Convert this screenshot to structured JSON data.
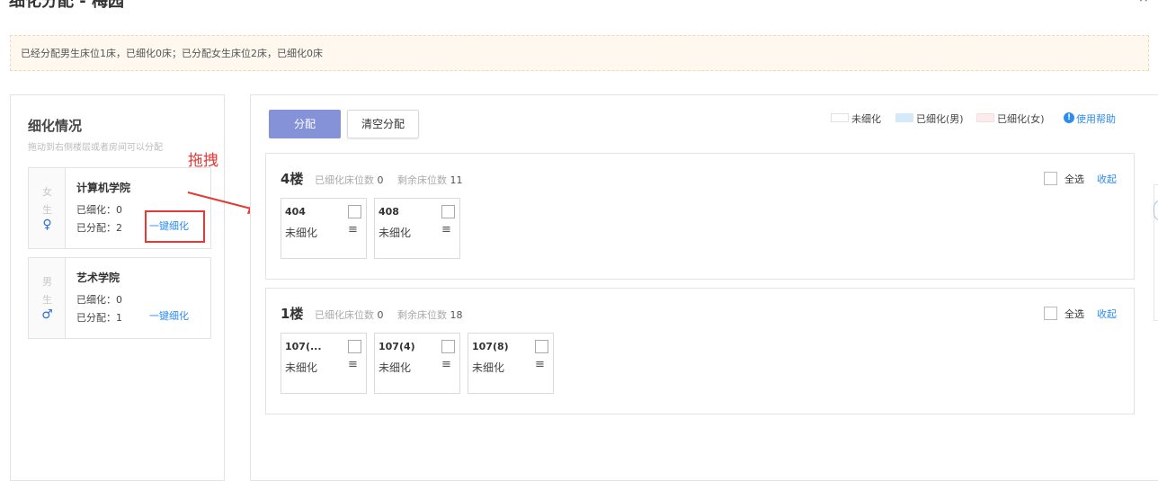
{
  "page_title": "细化分配 - 梅园",
  "close_glyph": "×",
  "notice": "已经分配男生床位1床，已细化0床；已分配女生床位2床，已细化0床",
  "left_panel": {
    "title": "细化情况",
    "subtitle": "拖动到右侧楼层或者房间可以分配",
    "colleges": [
      {
        "name": "计算机学院",
        "gender_chars": [
          "女",
          "生"
        ],
        "gender_icon": "female-icon",
        "gender_glyph": "♀",
        "refined_label": "已细化：",
        "refined_value": "0",
        "assigned_label": "已分配：",
        "assigned_value": "2",
        "action": "一键细化"
      },
      {
        "name": "艺术学院",
        "gender_chars": [
          "男",
          "生"
        ],
        "gender_icon": "male-icon",
        "gender_glyph": "♂",
        "refined_label": "已细化：",
        "refined_value": "0",
        "assigned_label": "已分配：",
        "assigned_value": "1",
        "action": "一键细化"
      }
    ]
  },
  "annotation": {
    "drag_label": "拖拽",
    "highlight_color": "#e53935"
  },
  "toolbar": {
    "assign_label": "分配",
    "clear_label": "清空分配"
  },
  "legend": [
    {
      "label": "未细化",
      "color": "#ffffff"
    },
    {
      "label": "已细化(男)",
      "color": "#d6e9fa"
    },
    {
      "label": "已细化(女)",
      "color": "#fcebec"
    }
  ],
  "help": {
    "icon_glyph": "!",
    "label": "使用帮助"
  },
  "floors": [
    {
      "name": "4楼",
      "refined_label": "已细化床位数",
      "refined_value": "0",
      "remaining_label": "剩余床位数",
      "remaining_value": "11",
      "select_all": "全选",
      "collapse": "收起",
      "rooms": [
        {
          "name": "404",
          "status": "未细化"
        },
        {
          "name": "408",
          "status": "未细化"
        }
      ]
    },
    {
      "name": "1楼",
      "refined_label": "已细化床位数",
      "refined_value": "0",
      "remaining_label": "剩余床位数",
      "remaining_value": "18",
      "select_all": "全选",
      "collapse": "收起",
      "rooms": [
        {
          "name": "107(...",
          "status": "未细化"
        },
        {
          "name": "107(4)",
          "status": "未细化"
        },
        {
          "name": "107(8)",
          "status": "未细化"
        }
      ]
    }
  ],
  "menu_glyph": "≡",
  "colors": {
    "primary": "#8592d8",
    "link": "#2d8cf0",
    "notice_bg": "#fef8ef"
  }
}
